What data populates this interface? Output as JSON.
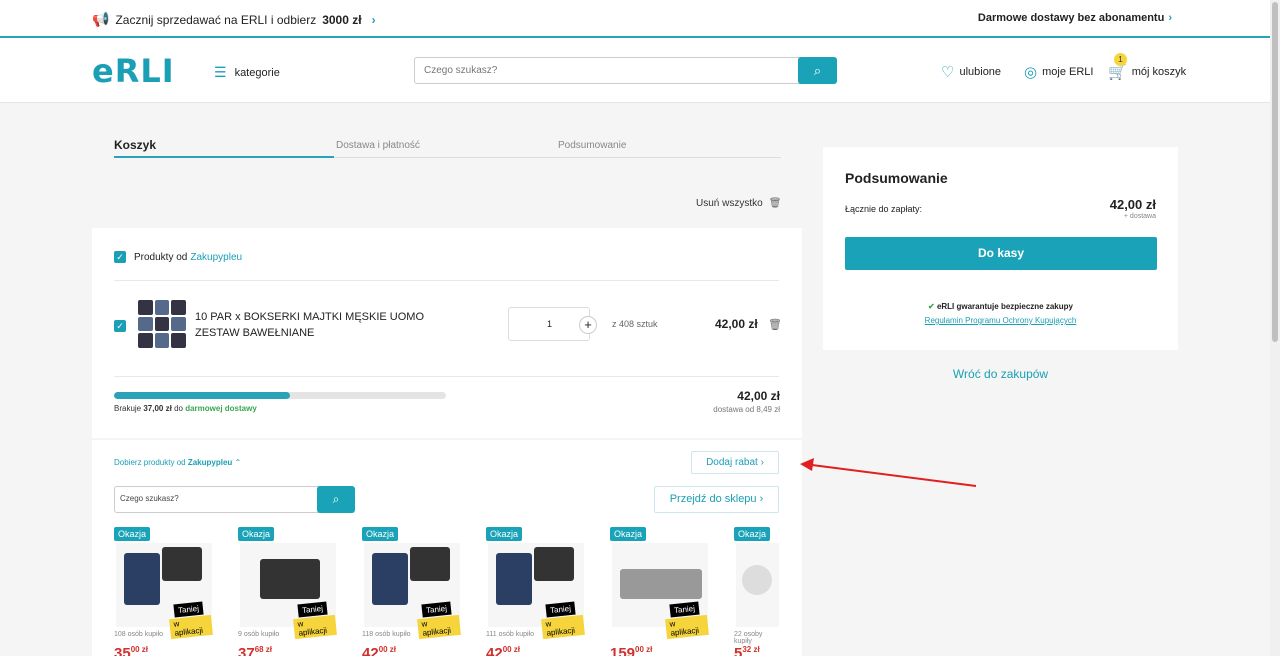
{
  "topbar": {
    "promo_text": "Zacznij sprzedawać na ERLI i odbierz",
    "promo_amount": "3000 zł",
    "right_text": "Darmowe dostawy bez abonamentu"
  },
  "header": {
    "logo": "eRLI",
    "categories": "kategorie",
    "search_placeholder": "Czego szukasz?",
    "favorites": "ulubione",
    "account": "moje ERLI",
    "cart": "mój koszyk",
    "cart_count": "1"
  },
  "steps": [
    "Koszyk",
    "Dostawa i płatność",
    "Podsumowanie"
  ],
  "cart": {
    "remove_all": "Usuń wszystko",
    "seller_prefix": "Produkty od",
    "seller": "Zakupypleu",
    "product_name": "10 PAR x BOKSERKI MAJTKI MĘSKIE UOMO ZESTAW BAWEŁNIANE",
    "quantity": "1",
    "stock": "z 408 sztuk",
    "price": "42,00 zł",
    "free_delivery_progress": 0.53,
    "missing_prefix": "Brakuje",
    "missing_amount": "37,00 zł",
    "missing_mid": "do",
    "missing_suffix": "darmowej dostawy",
    "subtotal": "42,00 zł",
    "delivery": "dostawa od 8,49 zł"
  },
  "more": {
    "label_prefix": "Dobierz produkty od",
    "seller": "Zakupypleu",
    "add_discount": "Dodaj rabat",
    "search_placeholder": "Czego szukasz?",
    "go_to_shop": "Przejdź do sklepu",
    "tiles": [
      {
        "badge": "Okazja",
        "bought": "108 osób kupiło",
        "price": "35",
        "cents": "00 zł",
        "tag1": "Taniej",
        "tag2": "w aplikacji"
      },
      {
        "badge": "Okazja",
        "bought": "9 osób kupiło",
        "price": "37",
        "cents": "68 zł",
        "tag1": "Taniej",
        "tag2": "w aplikacji"
      },
      {
        "badge": "Okazja",
        "bought": "118 osób kupiło",
        "price": "42",
        "cents": "00 zł",
        "tag1": "Taniej",
        "tag2": "w aplikacji"
      },
      {
        "badge": "Okazja",
        "bought": "111 osób kupiło",
        "price": "42",
        "cents": "00 zł",
        "tag1": "Taniej",
        "tag2": "w aplikacji"
      },
      {
        "badge": "Okazja",
        "bought": "",
        "price": "159",
        "cents": "00 zł",
        "tag1": "Taniej",
        "tag2": "w aplikacji"
      },
      {
        "badge": "Okazja",
        "bought": "22 osoby kupiły",
        "price": "5",
        "cents": "32 zł",
        "tag1": "",
        "tag2": ""
      }
    ]
  },
  "summary": {
    "title": "Podsumowanie",
    "total_label": "Łącznie do zapłaty:",
    "total": "42,00 zł",
    "plus_delivery": "+ dostawa",
    "checkout": "Do kasy",
    "guarantee": "eRLI gwarantuje bezpieczne zakupy",
    "regulations": "Regulamin Programu Ochrony Kupujących",
    "back": "Wróć do zakupów"
  },
  "colors": {
    "accent": "#1aa3b8",
    "price_red": "#d0312d",
    "annotation_arrow": "#e02020"
  }
}
